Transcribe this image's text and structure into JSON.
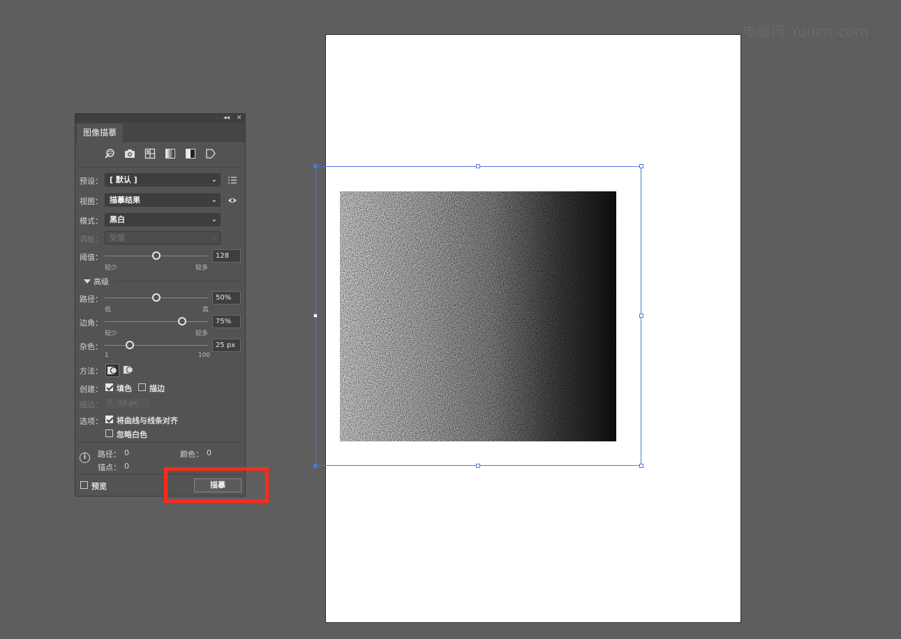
{
  "watermark": "电脑网 Yuucn.com",
  "panel": {
    "collapse_glyph": "◂◂",
    "close_glyph": "✕",
    "tab_title": "图像描摹",
    "preset_icons": [
      "auto-color-icon",
      "high-color-icon",
      "low-color-icon",
      "grayscale-icon",
      "black-white-icon",
      "outline-icon"
    ],
    "rows": {
      "preset": {
        "label": "预设：",
        "value": "[ 默认 ]"
      },
      "view": {
        "label": "视图：",
        "value": "描摹结果"
      },
      "mode": {
        "label": "模式：",
        "value": "黑白"
      },
      "palette": {
        "label": "调板：",
        "value": "受限"
      }
    },
    "threshold": {
      "label": "阈值：",
      "value": "128",
      "level": 128,
      "min": 1,
      "max": 255,
      "low_label": "较少",
      "high_label": "较多"
    },
    "advanced": {
      "label": "高级"
    },
    "paths": {
      "label": "路径：",
      "value": "50%",
      "level": 50,
      "low_label": "低",
      "high_label": "高"
    },
    "corners": {
      "label": "边角：",
      "value": "75%",
      "level": 75,
      "low_label": "较少",
      "high_label": "较多"
    },
    "noise": {
      "label": "杂色：",
      "value": "25 px",
      "level": 25,
      "low_label": "1",
      "high_label": "100"
    },
    "method": {
      "label": "方法："
    },
    "create": {
      "label": "创建：",
      "fill_label": "填色",
      "fill_checked": true,
      "stroke_label": "描边",
      "stroke_checked": false
    },
    "stroke": {
      "label": "描边：",
      "value": "10 px"
    },
    "options": {
      "label": "选项：",
      "snap_label": "将曲线与线条对齐",
      "snap_checked": true,
      "ignore_white_label": "忽略白色",
      "ignore_white_checked": false
    },
    "info": {
      "paths_label": "路径：",
      "paths_value": "0",
      "colors_label": "颜色：",
      "colors_value": "0",
      "anchors_label": "锚点：",
      "anchors_value": "0"
    },
    "preview": {
      "label": "预览",
      "checked": false
    },
    "trace_button": "描摹"
  },
  "colors": {
    "canvas_bg": "#5e5e5e",
    "panel_bg": "#535353",
    "selection": "#4a78d6",
    "highlight": "#ff2a1a"
  }
}
